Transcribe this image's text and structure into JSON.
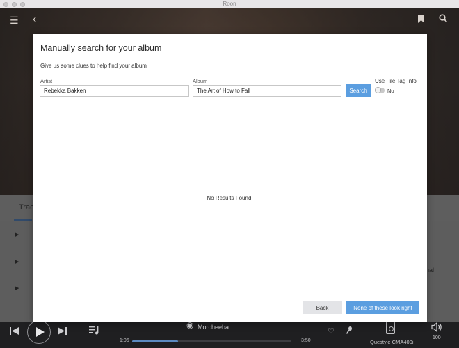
{
  "window": {
    "title": "Roon"
  },
  "background": {
    "tab_label": "Trac",
    "side_text": "nal"
  },
  "player": {
    "now_playing_artist": "Morcheeba",
    "time_elapsed": "1:06",
    "time_total": "3:50",
    "progress_fraction": 0.29,
    "zone_name": "Questyle CMA400i",
    "volume": "100"
  },
  "modal": {
    "title": "Manually search for your album",
    "subtitle": "Give us some clues to help find your album",
    "artist_label": "Artist",
    "artist_value": "Rebekka Bakken",
    "album_label": "Album",
    "album_value": "The Art of How to Fall",
    "search_label": "Search",
    "file_tag_label": "Use File Tag Info",
    "file_tag_state": "No",
    "no_results": "No Results Found.",
    "back_label": "Back",
    "none_label": "None of these look right"
  },
  "colors": {
    "accent": "#5b9ee0",
    "player_bg": "#1f1f21",
    "progress": "#5c8ac0"
  },
  "icons": [
    "hamburger-icon",
    "back-arrow-icon",
    "bookmark-icon",
    "search-icon",
    "previous-icon",
    "play-icon",
    "next-icon",
    "queue-icon",
    "heart-icon",
    "microphone-icon",
    "speaker-device-icon",
    "volume-icon"
  ]
}
